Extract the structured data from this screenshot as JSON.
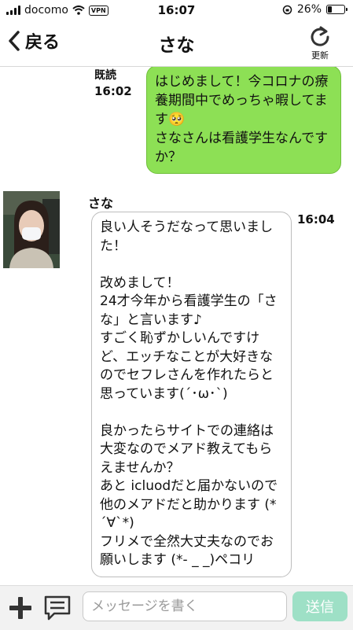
{
  "status_bar": {
    "carrier": "docomo",
    "vpn": "VPN",
    "time": "16:07",
    "battery": "26%",
    "battery_level": 0.26
  },
  "header": {
    "back_label": "戻る",
    "title": "さな",
    "refresh_label": "更新"
  },
  "messages": {
    "outgoing": {
      "read_label": "既読",
      "time": "16:02",
      "text": "はじめまして！今コロナの療養期間中でめっちゃ暇してます🥺\nさなさんは看護学生なんですか？"
    },
    "incoming": {
      "sender": "さな",
      "time": "16:04",
      "text": "良い人そうだなって思いました！\n\n改めまして！\n24才今年から看護学生の「さな」と言います♪\nすごく恥ずかしいんですけど、エッチなことが大好きなのでセフレさんを作れたらと思っています(´･ω･`)\n\n良かったらサイトでの連絡は大変なのでメアド教えてもらえませんか？\nあと icluodだと届かないので他のメアドだと助かります (*´∀`*)\nフリメで全然大丈夫なのでお願いします (*- _ _)ペコリ"
    }
  },
  "input_bar": {
    "placeholder": "メッセージを書く",
    "send_label": "送信"
  },
  "colors": {
    "outgoing_bubble": "#8de055",
    "send_button": "#9ee0c6"
  }
}
